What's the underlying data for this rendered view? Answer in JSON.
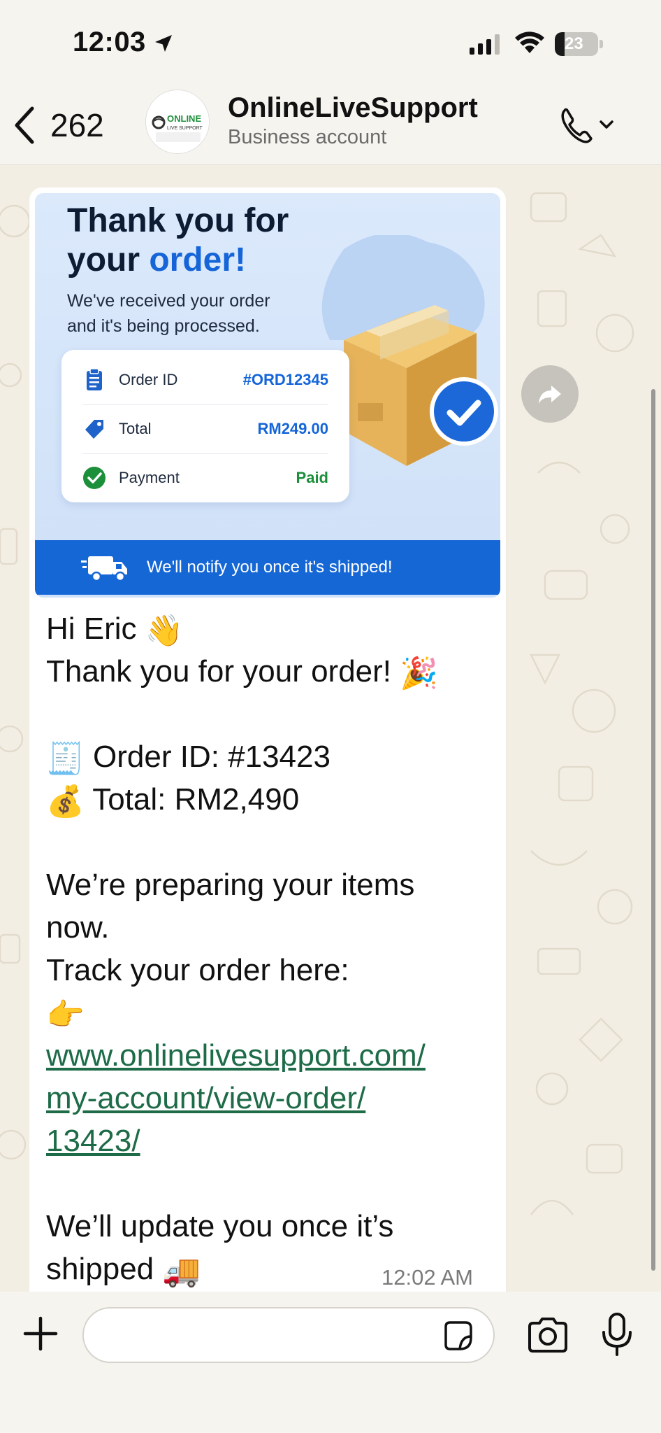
{
  "status_bar": {
    "time": "12:03",
    "battery": "23",
    "battery_level": 0.23
  },
  "header": {
    "back_count": "262",
    "contact_name": "OnlineLiveSupport",
    "contact_subtitle": "Business account",
    "avatar_logo_text": "ONLINE LIVE SUPPORT"
  },
  "message": {
    "image": {
      "title_line1": "Thank you for",
      "title_line2_a": "your ",
      "title_line2_b": "order!",
      "subtitle": "We've received your order and it's being processed.",
      "rows": [
        {
          "label": "Order ID",
          "value": "#ORD12345"
        },
        {
          "label": "Total",
          "value": "RM249.00"
        },
        {
          "label": "Payment",
          "value": "Paid"
        }
      ],
      "banner": "We'll notify you once it's shipped!"
    },
    "lines": {
      "greeting": "Hi Eric",
      "thanks": "Thank you for your order!",
      "order_id": "Order ID: #13423",
      "total": "Total: RM2,490",
      "preparing_1": "We’re preparing your items",
      "preparing_2": "now.",
      "track": "Track your order here:",
      "link_1": "www.onlinelivesupport.com/",
      "link_2": "my-account/view-order/",
      "link_3": "13423/",
      "update_1": "We’ll update you once it’s",
      "update_2": "shipped"
    },
    "emojis": {
      "wave": "👋",
      "party": "🎉",
      "receipt": "🧾",
      "money_bag": "💰",
      "point_right": "👉",
      "truck": "🚚"
    },
    "timestamp": "12:02 AM"
  },
  "input": {
    "value": "",
    "placeholder": ""
  },
  "colors": {
    "link": "#1d6b47",
    "accent_blue": "#1565d8",
    "chat_bg": "#f3eee4"
  }
}
